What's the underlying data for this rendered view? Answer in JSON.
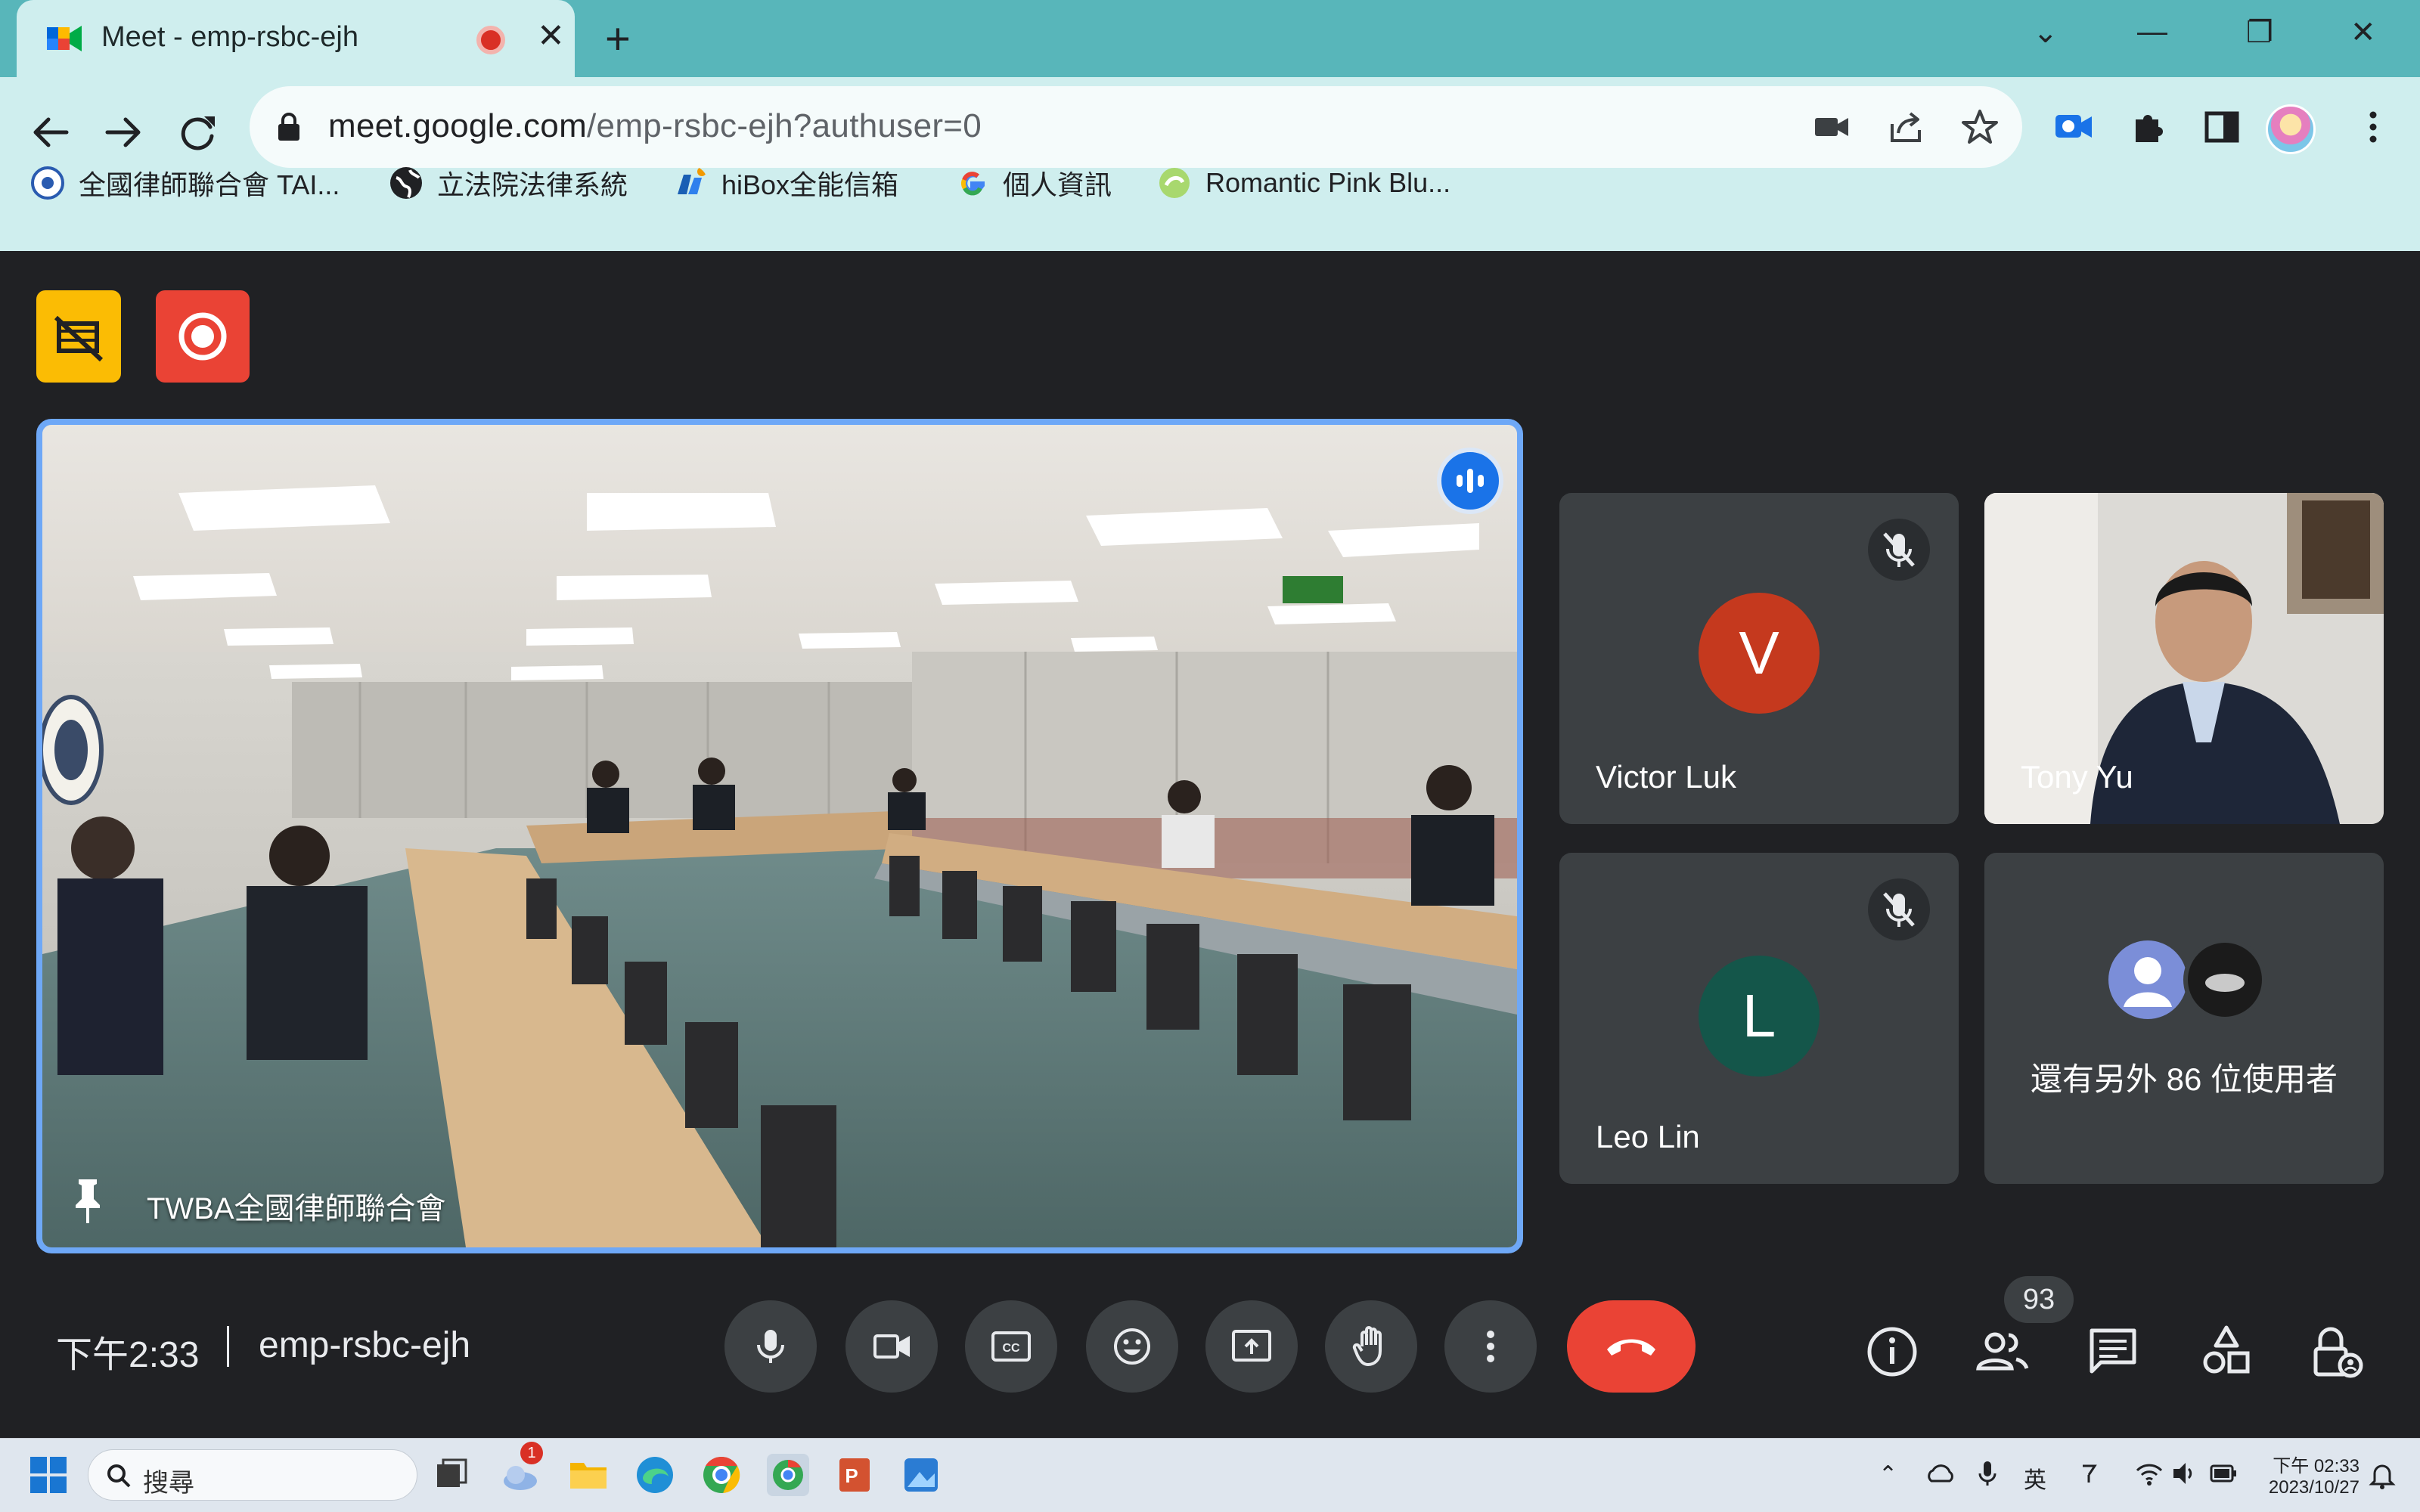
{
  "browser": {
    "tab_title": "Meet - emp-rsbc-ejh",
    "tab_close": "✕",
    "new_tab": "+",
    "window_controls": {
      "dropdown": "⌄",
      "minimize": "—",
      "restore": "❐",
      "close": "✕"
    },
    "url_host": "meet.google.com",
    "url_path": "/emp-rsbc-ejh?authuser=0"
  },
  "bookmarks": [
    {
      "label": "全國律師聯合會 TAI...",
      "icon": "twba-logo-icon"
    },
    {
      "label": "立法院法律系統",
      "icon": "globe-icon"
    },
    {
      "label": "hiBox全能信箱",
      "icon": "hibox-icon"
    },
    {
      "label": "個人資訊",
      "icon": "google-g-icon"
    },
    {
      "label": "Romantic Pink Blu...",
      "icon": "theme-icon"
    }
  ],
  "meet": {
    "main_tile_name": "TWBA全國律師聯合會",
    "participants": [
      {
        "name": "Victor Luk",
        "initial": "V",
        "color": "#c5391e",
        "muted": true
      },
      {
        "name": "Tony Yu",
        "initial": "",
        "color": "",
        "muted": false
      },
      {
        "name": "Leo Lin",
        "initial": "L",
        "color": "#14564a",
        "muted": true
      }
    ],
    "others_text": "還有另外 86 位使用者",
    "time": "下午2:33",
    "meeting_code": "emp-rsbc-ejh",
    "participant_count": "93"
  },
  "taskbar": {
    "search_placeholder": "搜尋",
    "notification_count": "1",
    "ime": "英",
    "clock_time": "下午 02:33",
    "clock_date": "2023/10/27"
  },
  "colors": {
    "tabbar": "#58b6ba",
    "toolbar": "#cfeeee",
    "meet_bg": "#202124",
    "tile_bg": "#3c4043",
    "active_border": "#6ea8f7",
    "end_call": "#ea4335"
  }
}
